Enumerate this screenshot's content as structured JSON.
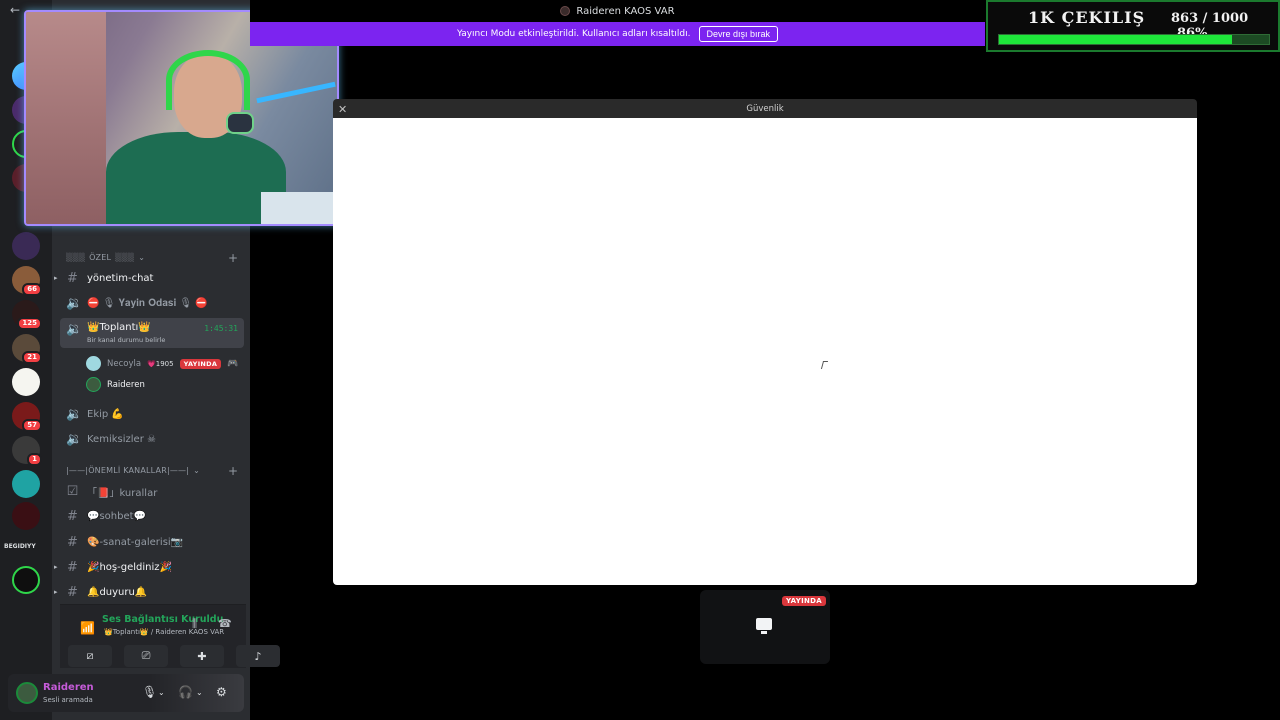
{
  "window": {
    "title": "Raideren KAOS VAR",
    "back_icon": "arrow-left-icon"
  },
  "streamer_banner": {
    "text": "Yayıncı Modu etkinleştirildi. Kullanıcı adları kısaltıldı.",
    "button_label": "Devre dışı bırak"
  },
  "giveaway": {
    "title": "1K ÇEKILIŞ",
    "count": "863 / 1000",
    "percent": "86%",
    "progress": 0.863
  },
  "server_rail": {
    "badges": [
      "66",
      "125",
      "21",
      "57",
      "1"
    ],
    "text_server": "BEGIDIYY"
  },
  "sidebar": {
    "category_private": "ÖZEL",
    "category_private_prefix": "▒▒▒",
    "category_private_suffix": "▒▒▒",
    "channels_private": [
      {
        "label": "yönetim-chat",
        "icon": "hash-icon"
      },
      {
        "label": "⛔ 🎙 𝐘𝐚𝐲𝐢𝐧 𝐎𝐝𝐚𝐬𝐢 🎙 ⛔",
        "icon": "speaker-icon"
      }
    ],
    "active_channel": {
      "label": "👑Toplantı👑",
      "time": "1:45:31",
      "status": "Bir kanal durumu belirle"
    },
    "voice_users": [
      {
        "name": "Necoyla",
        "extra": "💗1905",
        "live": "YAYINDA"
      },
      {
        "name": "Raideren"
      }
    ],
    "channels_more": [
      {
        "label": "Ekip 💪"
      },
      {
        "label": "Kemiksizler ☠"
      }
    ],
    "category_important": "|——|ÖNEMLİ KANALLAR|——|",
    "channels_important": [
      {
        "label": "「📕」kurallar",
        "icon": "rules-icon"
      },
      {
        "label": "💬sohbet💬",
        "icon": "hash-icon"
      },
      {
        "label": "🎨-sanat-galerisi📷",
        "icon": "hash-icon"
      },
      {
        "label": "🎉hoş-geldiniz🎉",
        "icon": "hash-icon"
      },
      {
        "label": "🔔duyuru🔔",
        "icon": "hash-icon"
      }
    ]
  },
  "voice_panel": {
    "title": "Ses Bağlantısı Kuruldu",
    "subtitle": "👑Toplantı👑 / Raideren KAOS VAR"
  },
  "user_panel": {
    "name": "Raideren",
    "status": "Sesli aramada"
  },
  "modal": {
    "title": "Güvenlik"
  },
  "stream_tile": {
    "live": "YAYINDA"
  }
}
